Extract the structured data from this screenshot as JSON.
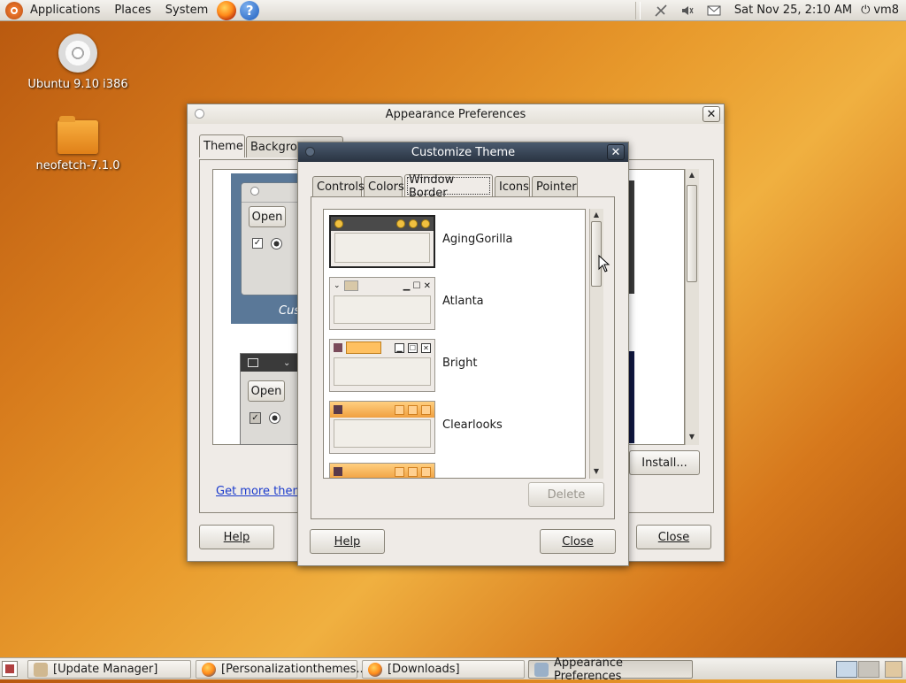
{
  "top_panel": {
    "menus": [
      "Applications",
      "Places",
      "System"
    ],
    "clock": "Sat Nov 25,  2:10 AM",
    "user": "vm8"
  },
  "desktop": {
    "icons": [
      {
        "label": "Ubuntu 9.10 i386",
        "icon": "cd-icon"
      },
      {
        "label": "neofetch-7.1.0",
        "icon": "folder-icon"
      }
    ]
  },
  "appearance": {
    "title": "Appearance Preferences",
    "tabs": [
      "Theme",
      "Background"
    ],
    "preview_labels": {
      "open1": "Open",
      "open2": "Open",
      "cus": "Cus"
    },
    "get_more": "Get more them",
    "install": "Install...",
    "help": "Help",
    "close": "Close"
  },
  "customize": {
    "title": "Customize Theme",
    "tabs": [
      "Controls",
      "Colors",
      "Window Border",
      "Icons",
      "Pointer"
    ],
    "active_tab": "Window Border",
    "themes": [
      "AgingGorilla",
      "Atlanta",
      "Bright",
      "Clearlooks",
      ""
    ],
    "selected": "AgingGorilla",
    "delete": "Delete",
    "help": "Help",
    "close": "Close"
  },
  "taskbar": {
    "tasks": [
      {
        "label": "[Update Manager]",
        "icon": "update-manager-icon"
      },
      {
        "label": "[Personalizationthemes...",
        "icon": "firefox-icon"
      },
      {
        "label": "[Downloads]",
        "icon": "firefox-icon"
      },
      {
        "label": "Appearance Preferences",
        "icon": "appearance-icon"
      }
    ]
  }
}
